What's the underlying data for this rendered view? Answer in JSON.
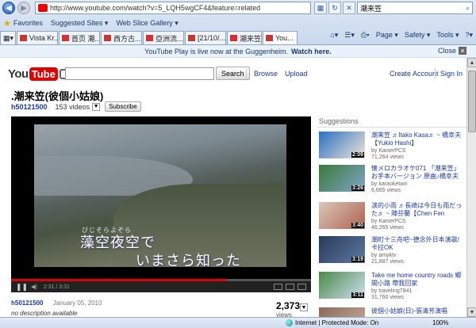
{
  "browser": {
    "url": "http://www.youtube.com/watch?v=5_LQH5wgCF4&feature=related",
    "search_text": "潮来笠",
    "favorites_label": "Favorites",
    "favbar": [
      "Suggested Sites ▾",
      "Web Slice Gallery ▾"
    ],
    "tabs": [
      "Vista Kr...",
      "首页 潮...",
      "西方古...",
      "亞洲流...",
      "[21/10/...",
      "潮来笠...",
      "You..."
    ],
    "commands": [
      "Page ▾",
      "Safety ▾",
      "Tools ▾"
    ],
    "status_zone": "Internet | Protected Mode: On",
    "zoom": "100%"
  },
  "banner": {
    "text": "YouTube Play is live now at the Guggenheim.",
    "link": "Watch here.",
    "close": "Close"
  },
  "header": {
    "logo_you": "You",
    "logo_tube": "Tube",
    "search_button": "Search",
    "links": [
      "Browse",
      "Upload",
      "Create Account",
      "Sign In"
    ]
  },
  "video": {
    "title": ".潮来笠(彼個小姑娘)",
    "uploader": "h50121500",
    "video_count": "153 videos",
    "subscribe": "Subscribe",
    "subtitle_ruby": "びじそらよぞら",
    "subtitle_line1": "藻空夜空で",
    "subtitle_line2": "いまさら知った",
    "time": "2:31 / 3:31",
    "progress": 0.72,
    "date": "January 05, 2010",
    "description": "no description available",
    "views": "2,373",
    "views_label": "views"
  },
  "suggestions": {
    "heading": "Suggestions",
    "items": [
      {
        "title": "潮来笠 ♬Itako Kasa♬ ~ 橋幸夫【Yukio Hashi】",
        "by": "by KaiserPCS",
        "views": "71,264 views",
        "duration": "2:09",
        "colors": [
          "#2a6fc0",
          "#f0e6d8"
        ]
      },
      {
        "title": "懐メロカラオケ071 「潮来笠」お手本バージョン 原曲♪橋幸夫",
        "by": "by karaoketairi",
        "views": "6,665 views",
        "duration": "3:26",
        "colors": [
          "#3a7a3a",
          "#7fa6c8"
        ]
      },
      {
        "title": "涙的小雨 ♬長崎は今日も雨だった♬ ~ 陣芬蘭【Chen Fen",
        "by": "by KaiserPCS",
        "views": "46,265 views",
        "duration": "3:40",
        "colors": [
          "#d8c8b8",
          "#b06050"
        ]
      },
      {
        "title": "潮町十三舟吧~德念外日本演歌/卡拉OK",
        "by": "by amyktv",
        "views": "21,887 views",
        "duration": "3:19",
        "colors": [
          "#2a3a5a",
          "#5a7aa0"
        ]
      },
      {
        "title": "Take me home country roads 鄉間小路 帶我回家",
        "by": "by traveling7841",
        "views": "31,760 views",
        "duration": "3:11",
        "colors": [
          "#4a8a4a",
          "#cfe0f0"
        ]
      },
      {
        "title": "彼個小姑娘(日)-張清芳演唱",
        "by": "",
        "views": "",
        "duration": "",
        "colors": [
          "#8a6a5a",
          "#c8b0a0"
        ]
      }
    ]
  }
}
